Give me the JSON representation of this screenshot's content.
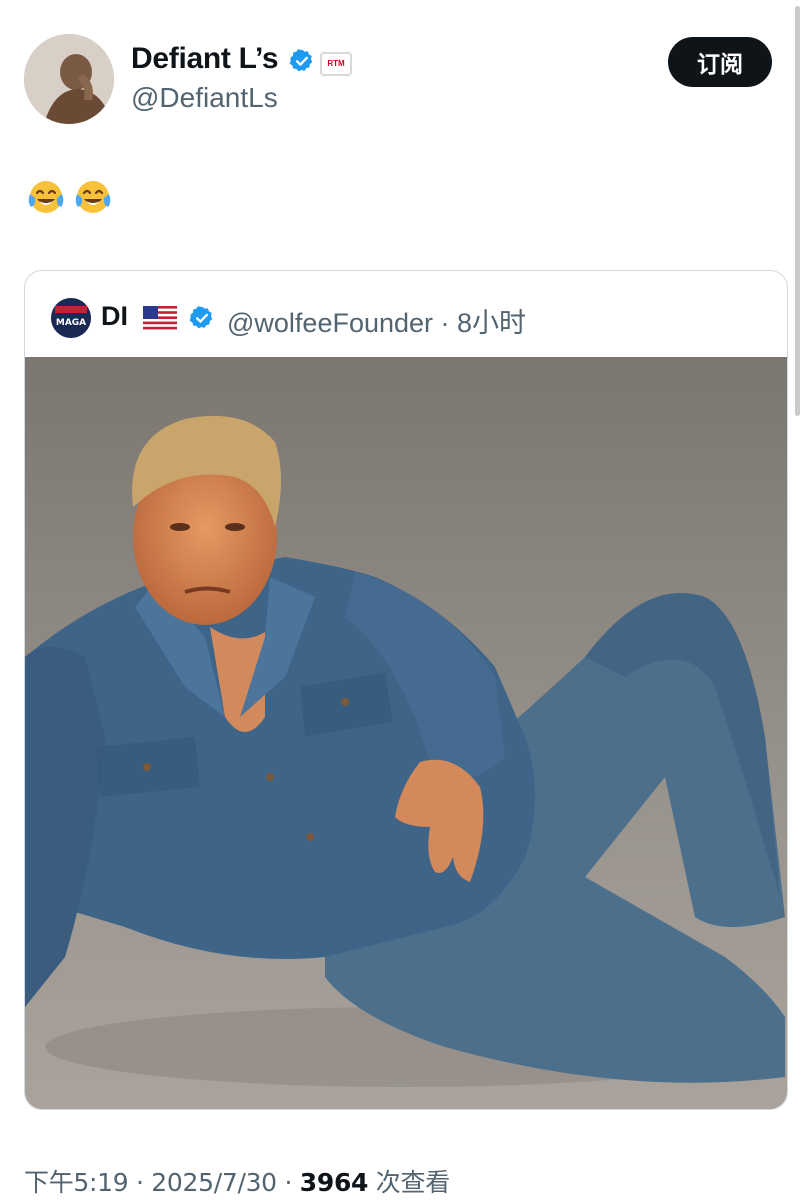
{
  "tweet": {
    "display_name": "Defiant L’s",
    "handle": "@DefiantLs",
    "badge_text": "RTM",
    "subscribe_label": "订阅",
    "body_icons": [
      "face-with-tears-of-joy-icon",
      "face-with-tears-of-joy-icon"
    ]
  },
  "quote": {
    "avatar_text": "MAGA",
    "display_name": "DI",
    "flag_icon": "us-flag-icon",
    "handle_time": "@wolfeeFounder · 8小时",
    "image_icon": "man-in-denim-photo"
  },
  "footer": {
    "time": "下午5:19",
    "sep1": " · ",
    "date": "2025/7/30",
    "sep2": " · ",
    "views_count": "3964",
    "views_label": " 次查看"
  },
  "colors": {
    "verified_blue": "#1d9bf0",
    "text_primary": "#0f1419",
    "text_secondary": "#536471",
    "subscribe_bg": "#0f1419"
  }
}
